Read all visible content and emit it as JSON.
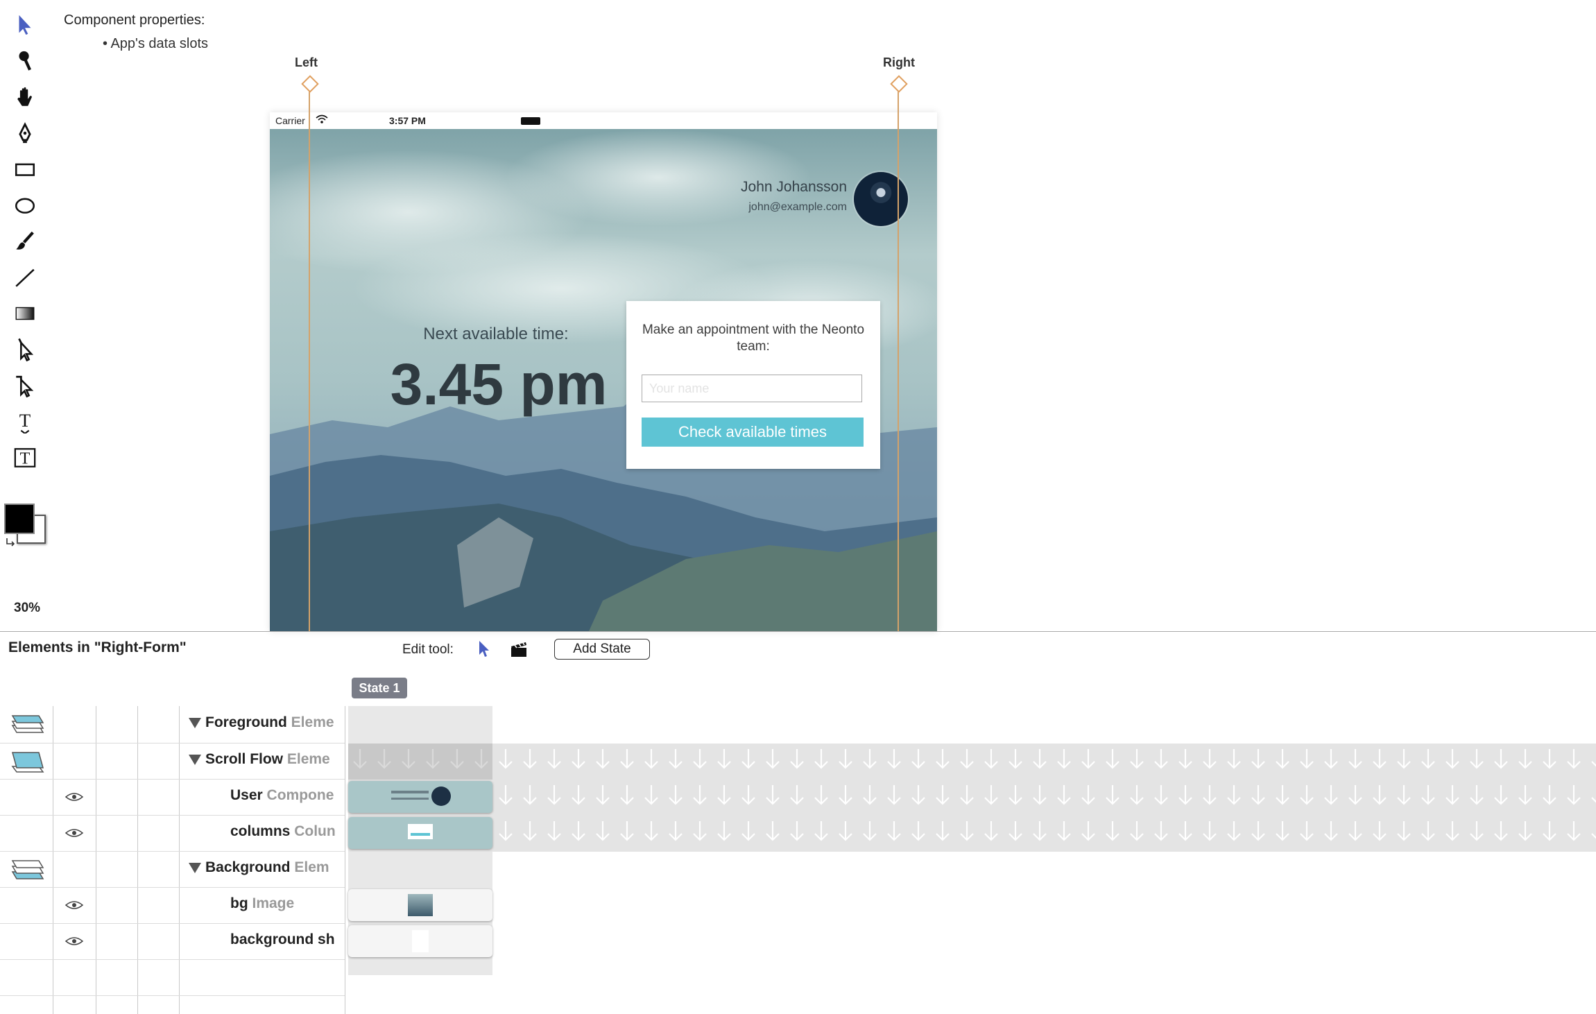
{
  "properties": {
    "title": "Component properties:",
    "items": [
      "App's data slots"
    ]
  },
  "tools": [
    "select-arrow-icon",
    "eyedropper-icon",
    "hand-icon",
    "pen-icon",
    "rectangle-icon",
    "ellipse-icon",
    "brush-icon",
    "line-icon",
    "gradient-icon",
    "direct-select-icon",
    "path-select-icon",
    "text-on-path-icon",
    "text-box-icon"
  ],
  "colors": {
    "foreground": "#000000",
    "background": "#ffffff",
    "accent": "#5ec4d4",
    "guide": "#d4a26a"
  },
  "zoom": "30%",
  "guides": {
    "left": "Left",
    "right": "Right"
  },
  "device": {
    "status": {
      "carrier": "Carrier",
      "time": "3:57 PM"
    },
    "user": {
      "name": "John Johansson",
      "email": "john@example.com"
    },
    "next_label": "Next available time:",
    "next_time": "3.45 pm",
    "form": {
      "title": "Make an appointment with the Neonto team:",
      "placeholder": "Your name",
      "button": "Check available times"
    }
  },
  "panel": {
    "title": "Elements in \"Right-Form\"",
    "edit_tool_label": "Edit tool:",
    "add_state": "Add State",
    "state_tab": "State 1",
    "rows": [
      {
        "name": "Foreground",
        "type": "Eleme"
      },
      {
        "name": "Scroll Flow",
        "type": "Eleme"
      },
      {
        "name": "User",
        "type": "Compone"
      },
      {
        "name": "columns",
        "type": "Colun"
      },
      {
        "name": "Background",
        "type": "Elem"
      },
      {
        "name": "bg",
        "type": "Image"
      },
      {
        "name": "background sh",
        "type": ""
      }
    ]
  }
}
